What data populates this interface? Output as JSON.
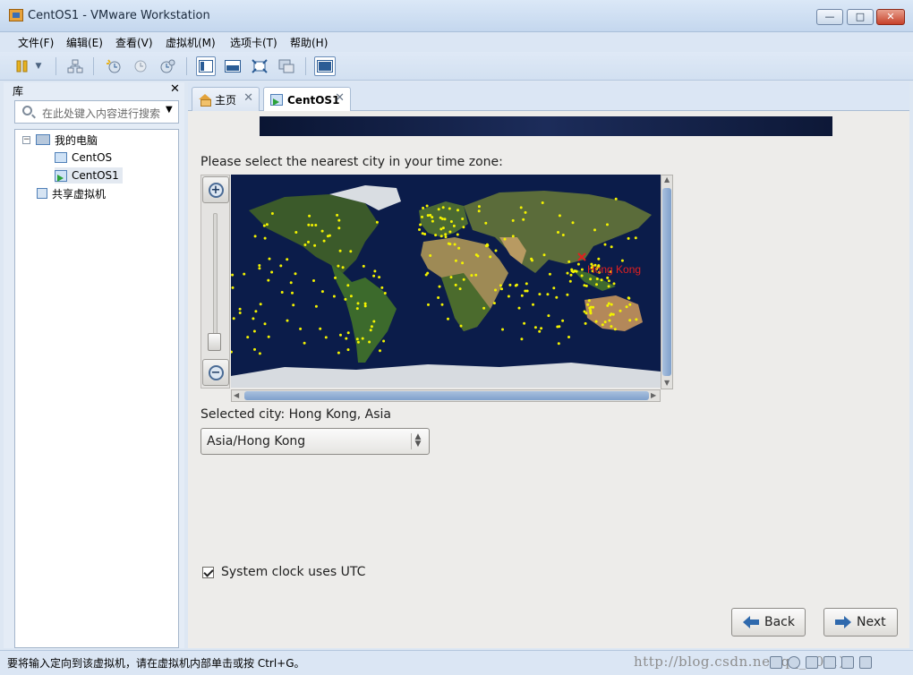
{
  "window": {
    "title": "CentOS1 - VMware Workstation",
    "minimize": "—",
    "maximize": "□",
    "close": "✕"
  },
  "menu": [
    "文件(F)",
    "编辑(E)",
    "查看(V)",
    "虚拟机(M)",
    "选项卡(T)",
    "帮助(H)"
  ],
  "library": {
    "header": "库",
    "close": "✕",
    "search_placeholder": "在此处键入内容进行搜索",
    "tree": {
      "root": "我的电脑",
      "vm1": "CentOS",
      "vm2": "CentOS1",
      "shared": "共享虚拟机"
    }
  },
  "tabs": [
    {
      "label": "主页",
      "close": "✕"
    },
    {
      "label": "CentOS1",
      "close": "✕"
    }
  ],
  "installer": {
    "prompt": "Please select the nearest city in your time zone:",
    "map_city_label": "Hong Kong",
    "selected_city": "Selected city: Hong Kong, Asia",
    "timezone_value": "Asia/Hong Kong",
    "utc_label": "System clock uses UTC",
    "utc_checked": true,
    "back_label": "Back",
    "next_label": "Next"
  },
  "status": {
    "message": "要将输入定向到该虚拟机，请在虚拟机内部单击或按 Ctrl+G。",
    "watermark": "http://blog.csdn.net/qq_20(1)"
  },
  "icons": [
    "pause-icon",
    "dropdown-icon",
    "network-icon",
    "snapshot-icon",
    "revert-icon",
    "snapshot-manager-icon",
    "console-view-icon",
    "fullscreen-icon",
    "unity-icon",
    "thumbnail-icon",
    "search-icon",
    "computer-icon",
    "vm-icon",
    "shared-vm-icon",
    "home-icon",
    "zoom-in-icon",
    "zoom-out-icon",
    "back-arrow-icon",
    "next-arrow-icon"
  ],
  "colors": {
    "accent": "#2f69ad",
    "city_marker": "#e02020",
    "city_dot": "#f2f200"
  }
}
